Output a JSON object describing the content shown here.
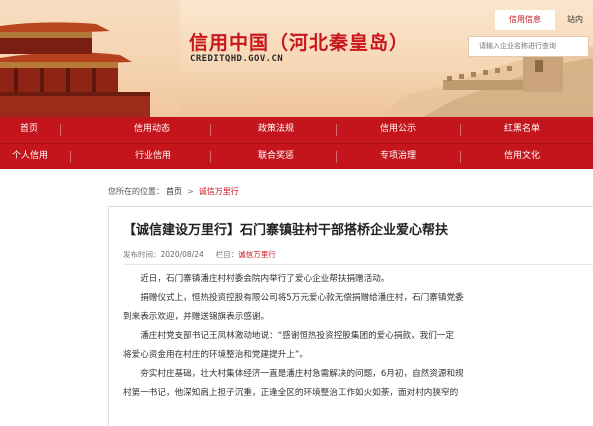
{
  "header": {
    "title": "信用中国（河北秦皇岛）",
    "domain": "CREDITQHD.GOV.CN",
    "top_tabs": [
      "信用信息",
      "站内"
    ],
    "search_placeholder": "请输入企业名称进行查询"
  },
  "nav": {
    "row1": [
      "首页",
      "信用动态",
      "政策法规",
      "信用公示",
      "红黑名单"
    ],
    "row2": [
      "个人信用",
      "行业信用",
      "联合奖惩",
      "专项治理",
      "信用文化"
    ]
  },
  "breadcrumb": {
    "label": "您所在的位置：",
    "home": "首页",
    "separator": ">",
    "current": "诚信万里行"
  },
  "article": {
    "title": "【诚信建设万里行】石门寨镇驻村干部搭桥企业爱心帮扶",
    "date_label": "发布时间：",
    "date": "2020/08/24",
    "column_label": "栏目：",
    "column": "诚信万里行",
    "paragraph_lines": [
      "　　近日，石门寨镇潘庄村村委会院内举行了爱心企业帮扶捐赠活动。",
      "　　捐赠仪式上，恒热投资控股有限公司将5万元爱心款无偿捐赠给潘庄村，石门寨镇党委",
      "到来表示欢迎，并赠送锦旗表示感谢。",
      "　　潘庄村党支部书记王凤林激动地说：“感谢恒热投资控股集团的爱心捐款，我们一定",
      "将爱心资金用在村庄的环境整治和党建提升上”。",
      "　　夯实村庄基础，壮大村集体经济一直是潘庄村急需解决的问题，6月初，自然资源和规",
      "村第一书记，他深知肩上担子沉重，正逢全区的环境整治工作如火如荼，面对村内狭窄的"
    ]
  },
  "colors": {
    "brand_red": "#c8161d",
    "nav_red": "#c4151c",
    "banner_bg": "#f6d7b6"
  }
}
